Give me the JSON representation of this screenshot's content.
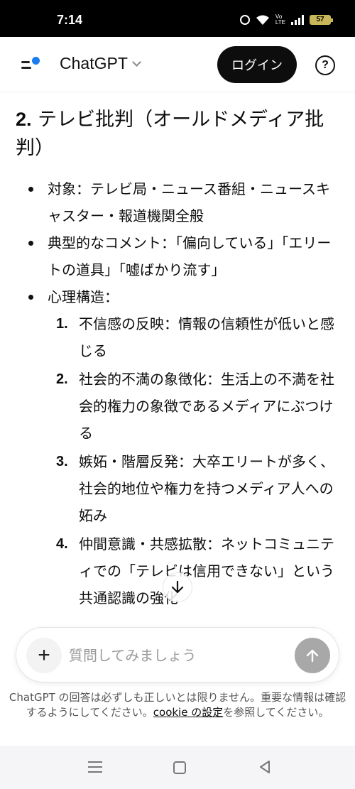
{
  "status_bar": {
    "time": "7:14",
    "battery": "57",
    "icons": [
      "alarm-icon",
      "wifi-icon",
      "volte-icon",
      "signal-icon",
      "battery-icon"
    ]
  },
  "header": {
    "model_name": "ChatGPT",
    "login_label": "ログイン",
    "help_label": "?"
  },
  "content": {
    "heading_number": "2.",
    "heading_text": "テレビ批判（オールドメディア批判）",
    "bullets": [
      {
        "text": "対象：テレビ局・ニュース番組・ニュースキャスター・報道機関全般"
      },
      {
        "text": "典型的なコメント：「偏向している」「エリートの道具」「嘘ばかり流す」"
      },
      {
        "text": "心理構造："
      }
    ],
    "structure_items": [
      {
        "num": "1.",
        "text": "不信感の反映：情報の信頼性が低いと感じる"
      },
      {
        "num": "2.",
        "text": "社会的不満の象徴化：生活上の不満を社会的権力の象徴であるメディアにぶつける"
      },
      {
        "num": "3.",
        "text": "嫉妬・階層反発：大卒エリートが多く、社会的地位や権力を持つメディア人への妬み"
      },
      {
        "num": "4.",
        "text": "仲間意識・共感拡散：ネットコミュニティでの「テレビは信用できない」という共通認識の強化"
      }
    ]
  },
  "composer": {
    "placeholder": "質問してみましょう"
  },
  "disclaimer": {
    "part1": "ChatGPT の回答は必ずしも正しいとは限りません。重要な情報は確認するようにしてください。",
    "link": "cookie の設定",
    "part2": "を参照してください。"
  },
  "colors": {
    "accent_dot": "#1a7cf0",
    "login_bg": "#0d0d0d",
    "send_disabled": "#a8a8a8"
  }
}
